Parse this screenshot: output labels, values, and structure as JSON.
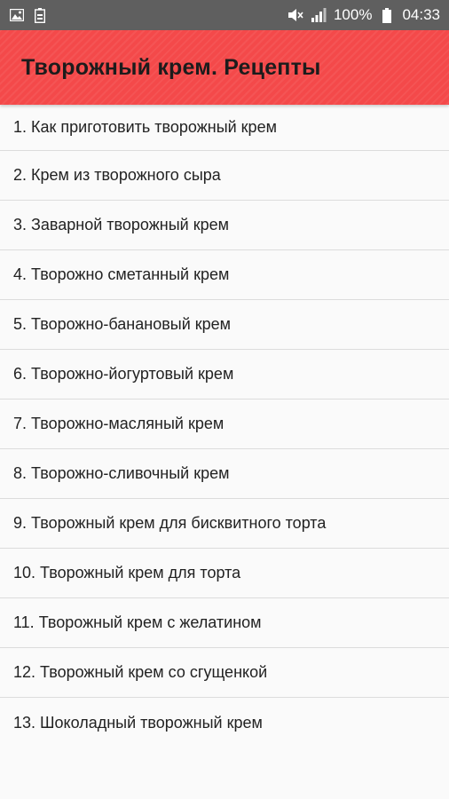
{
  "statusbar": {
    "left_icons": [
      "image-icon",
      "battery-saver-icon"
    ],
    "battery": "100%",
    "time": "04:33"
  },
  "appbar": {
    "title": "Творожный крем. Рецепты",
    "color": "#f4494a"
  },
  "recipes": [
    "1. Как приготовить творожный крем",
    "2. Крем из творожного сыра",
    "3. Заварной творожный крем",
    "4. Творожно сметанный крем",
    "5. Творожно-банановый крем",
    "6. Творожно-йогуртовый крем",
    "7. Творожно-масляный крем",
    "8. Творожно-сливочный крем",
    "9. Творожный крем для бисквитного торта",
    "10. Творожный крем для торта",
    "11. Творожный крем с желатином",
    "12. Творожный крем со сгущенкой",
    "13. Шоколадный творожный крем"
  ]
}
